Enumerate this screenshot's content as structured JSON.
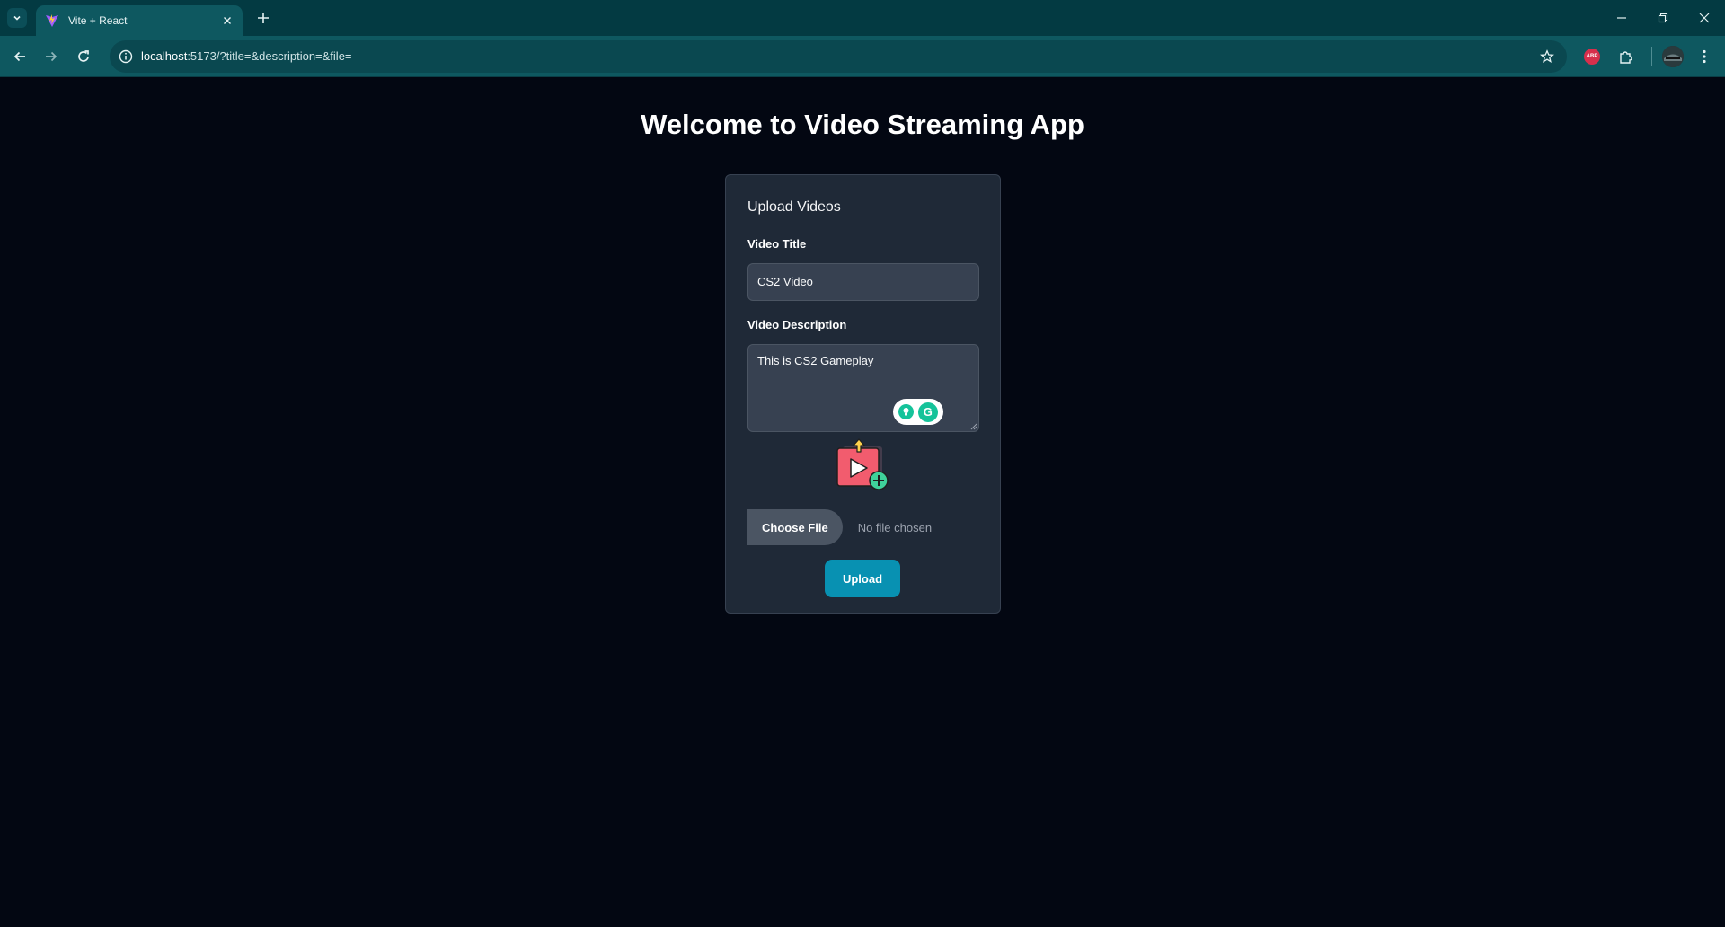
{
  "browser": {
    "tab_title": "Vite + React",
    "url_host": "localhost",
    "url_rest": ":5173/?title=&description=&file=",
    "extension_badge": "ABP"
  },
  "page": {
    "heading": "Welcome to Video Streaming App"
  },
  "upload_form": {
    "card_title": "Upload Videos",
    "title_label": "Video Title",
    "title_value": "CS2 Video",
    "description_label": "Video Description",
    "description_value": "This is CS2 Gameplay",
    "choose_file_label": "Choose File",
    "file_status": "No file chosen",
    "upload_label": "Upload"
  },
  "grammarly": {
    "letter": "G"
  },
  "colors": {
    "page_background": "#030712",
    "card_background": "#1f2937",
    "accent": "#0891b2",
    "chrome_tabbar": "#033a42",
    "chrome_toolbar": "#0e5860"
  }
}
